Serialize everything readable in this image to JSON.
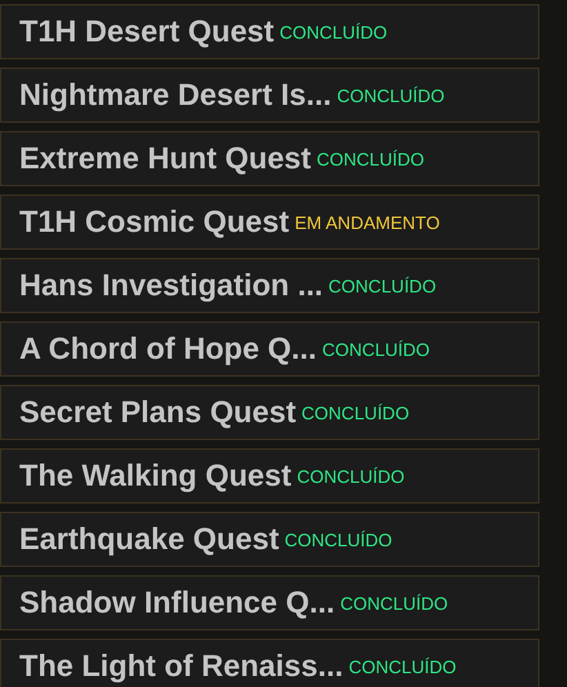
{
  "quests": [
    {
      "title": "T1H Desert Quest",
      "status": "CONCLUÍDO",
      "kind": "done"
    },
    {
      "title": "Nightmare Desert Is...",
      "status": "CONCLUÍDO",
      "kind": "done"
    },
    {
      "title": "Extreme Hunt Quest",
      "status": "CONCLUÍDO",
      "kind": "done"
    },
    {
      "title": "T1H Cosmic Quest",
      "status": "EM ANDAMENTO",
      "kind": "in_progress"
    },
    {
      "title": "Hans Investigation ...",
      "status": "CONCLUÍDO",
      "kind": "done"
    },
    {
      "title": "A Chord of Hope Q...",
      "status": "CONCLUÍDO",
      "kind": "done"
    },
    {
      "title": "Secret Plans Quest",
      "status": "CONCLUÍDO",
      "kind": "done"
    },
    {
      "title": "The Walking Quest",
      "status": "CONCLUÍDO",
      "kind": "done"
    },
    {
      "title": "Earthquake Quest",
      "status": "CONCLUÍDO",
      "kind": "done"
    },
    {
      "title": "Shadow Influence Q...",
      "status": "CONCLUÍDO",
      "kind": "done"
    },
    {
      "title": "The Light of Renaiss...",
      "status": "CONCLUÍDO",
      "kind": "done"
    }
  ]
}
